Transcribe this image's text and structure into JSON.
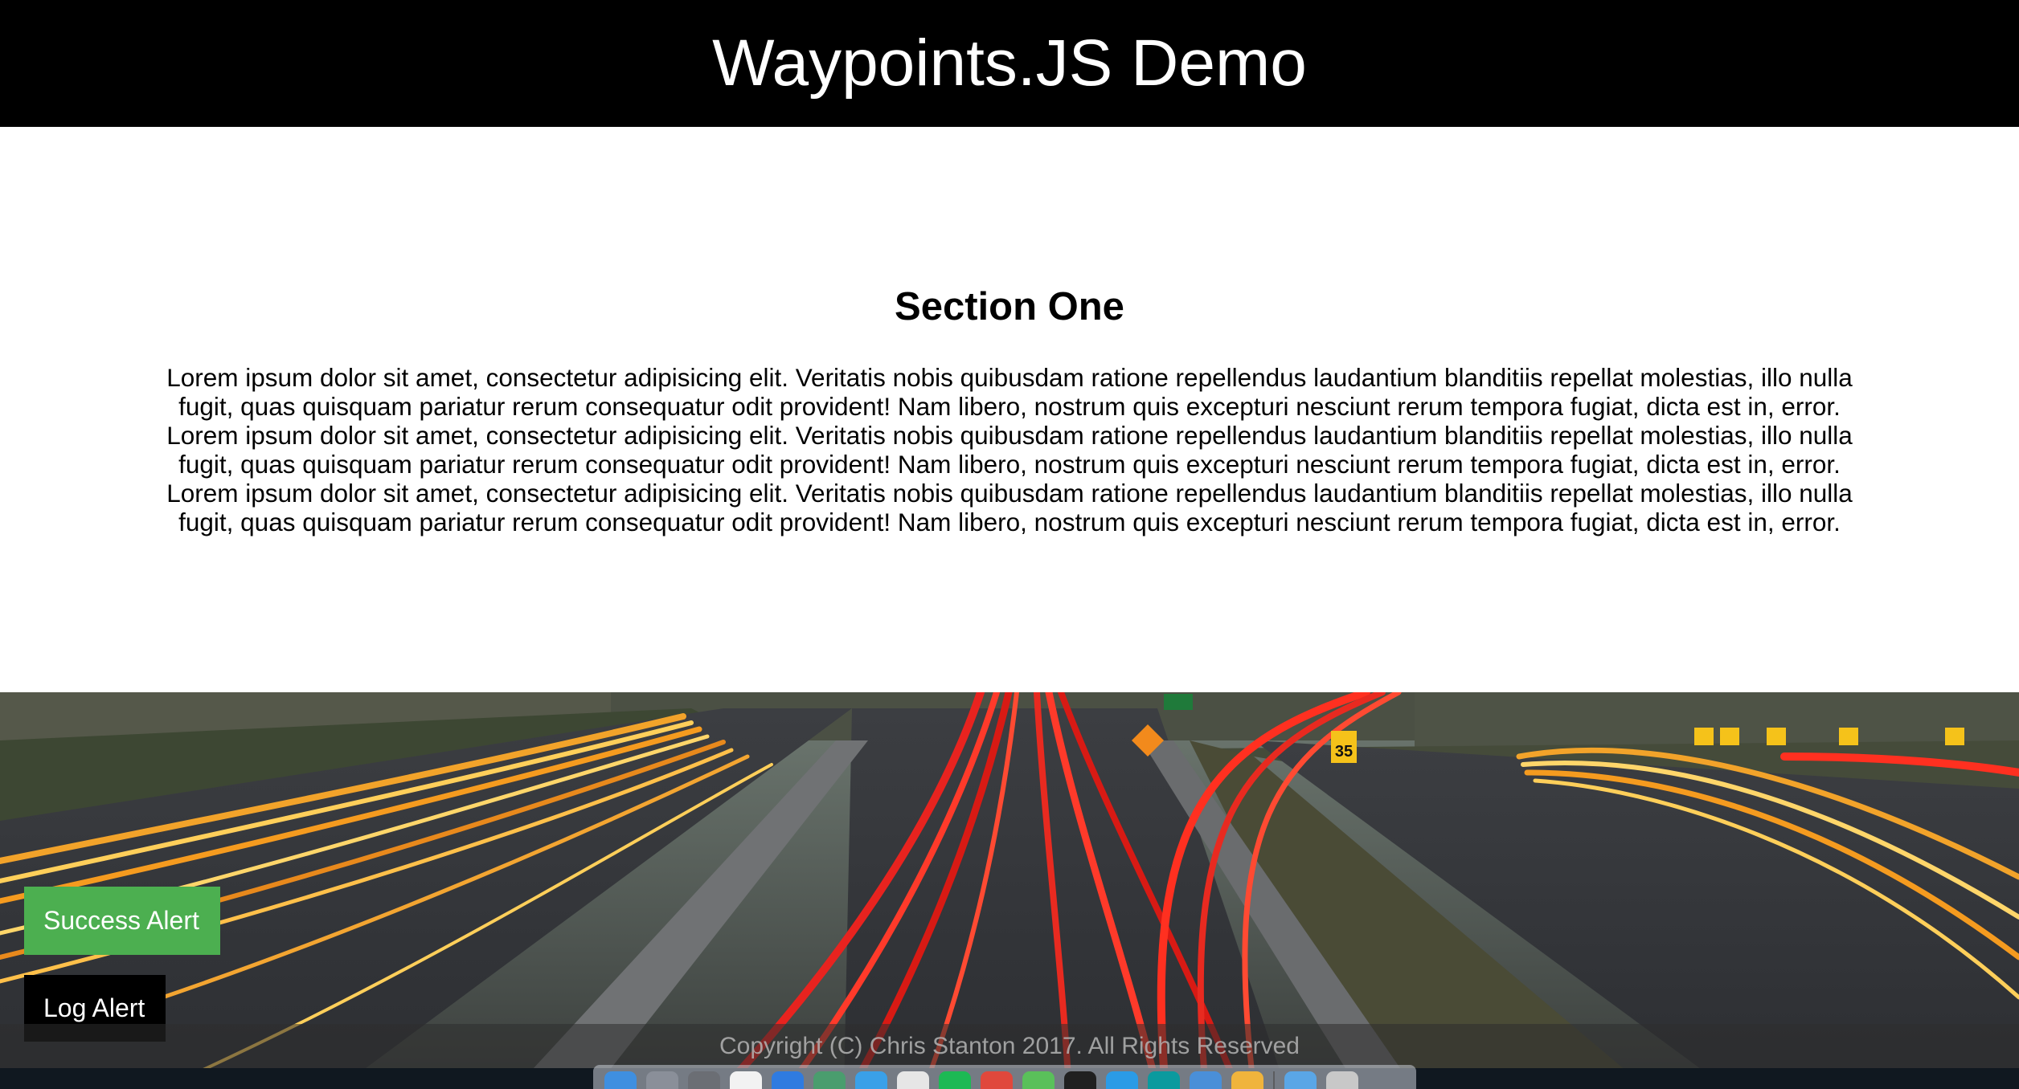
{
  "header": {
    "title": "Waypoints.JS Demo"
  },
  "section": {
    "title": "Section One",
    "paragraph_lines": [
      "Lorem ipsum dolor sit amet, consectetur adipisicing elit. Veritatis nobis quibusdam ratione repellendus laudantium blanditiis repellat molestias, illo nulla",
      "fugit, quas quisquam pariatur rerum consequatur odit provident! Nam libero, nostrum quis excepturi nesciunt rerum tempora fugiat, dicta est in, error.",
      "Lorem ipsum dolor sit amet, consectetur adipisicing elit. Veritatis nobis quibusdam ratione repellendus laudantium blanditiis repellat molestias, illo nulla",
      "fugit, quas quisquam pariatur rerum consequatur odit provident! Nam libero, nostrum quis excepturi nesciunt rerum tempora fugiat, dicta est in, error.",
      "Lorem ipsum dolor sit amet, consectetur adipisicing elit. Veritatis nobis quibusdam ratione repellendus laudantium blanditiis repellat molestias, illo nulla",
      "fugit, quas quisquam pariatur rerum consequatur odit provident! Nam libero, nostrum quis excepturi nesciunt rerum tempora fugiat, dicta est in, error."
    ]
  },
  "photo": {
    "sign_exit": "35"
  },
  "buttons": {
    "success_label": "Success Alert",
    "log_label": "Log Alert"
  },
  "footer": {
    "copyright": "Copyright (C) Chris Stanton 2017. All Rights Reserved"
  },
  "dock": {
    "icons": [
      {
        "name": "finder-icon",
        "color": "#3f8fe0"
      },
      {
        "name": "launchpad-icon",
        "color": "#8a8f99"
      },
      {
        "name": "system-preferences-icon",
        "color": "#6b6e74"
      },
      {
        "name": "calendar-icon",
        "color": "#f2f2f2"
      },
      {
        "name": "app-store-icon",
        "color": "#2f7be0"
      },
      {
        "name": "preview-icon",
        "color": "#4a9d6e"
      },
      {
        "name": "safari-icon",
        "color": "#3aa0e8"
      },
      {
        "name": "textedit-icon",
        "color": "#e6e6e6"
      },
      {
        "name": "spotify-icon",
        "color": "#1db954"
      },
      {
        "name": "chrome-icon",
        "color": "#e0483c"
      },
      {
        "name": "messages-icon",
        "color": "#5ac05a"
      },
      {
        "name": "terminal-icon",
        "color": "#202020"
      },
      {
        "name": "vscode-icon",
        "color": "#2b9be6"
      },
      {
        "name": "arduino-icon",
        "color": "#0b9a9e"
      },
      {
        "name": "xcode-icon",
        "color": "#4a8fd8"
      },
      {
        "name": "sketch-icon",
        "color": "#f0b43c"
      },
      {
        "name": "folder-icon",
        "color": "#5aa6e6"
      },
      {
        "name": "trash-icon",
        "color": "#c8c8c8"
      }
    ]
  },
  "colors": {
    "header_bg": "#000000",
    "success": "#4caf50",
    "log": "#000000"
  }
}
